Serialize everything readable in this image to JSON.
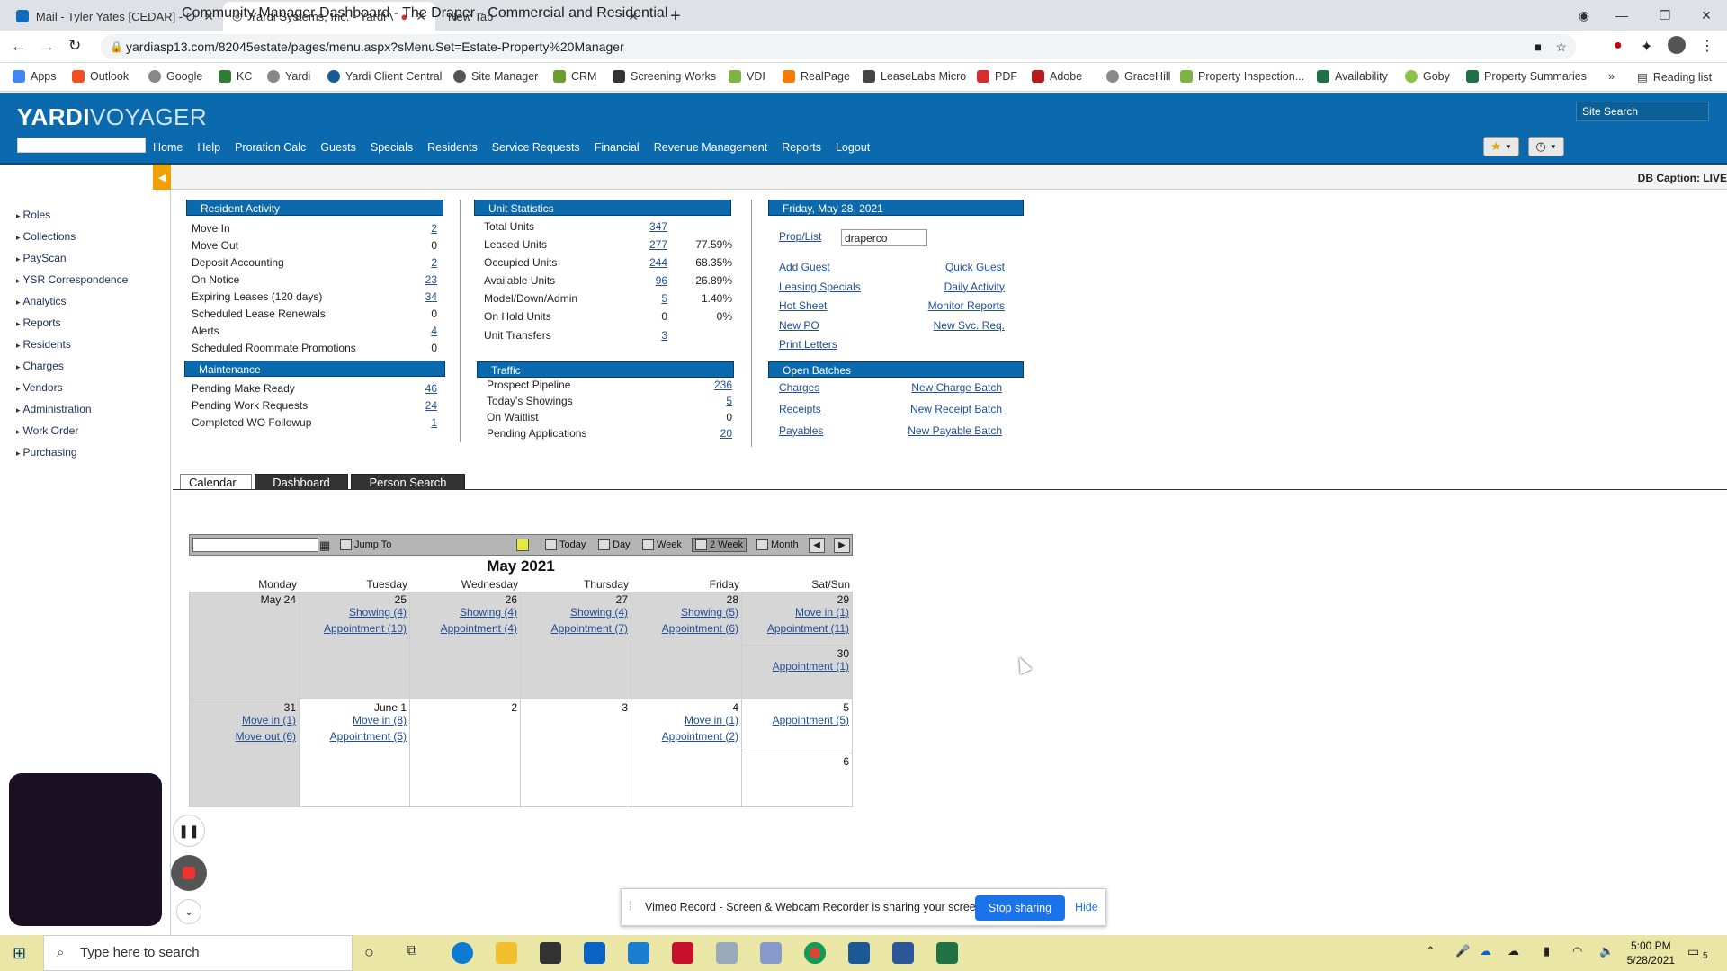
{
  "browser": {
    "tabs": [
      {
        "title": "Mail - Tyler Yates [CEDAR] - Outl"
      },
      {
        "title": "Yardi Systems, Inc. - Yardi Vo"
      },
      {
        "title": "New Tab"
      }
    ],
    "url": "yardiasp13.com/82045estate/pages/menu.aspx?sMenuSet=Estate-Property%20Manager",
    "bookmarks": [
      "Apps",
      "Outlook",
      "Google",
      "KC",
      "Yardi",
      "Yardi Client Central",
      "Site Manager",
      "CRM",
      "Screening Works",
      "VDI",
      "RealPage",
      "LeaseLabs Micro",
      "PDF",
      "Adobe",
      "GraceHill",
      "Property Inspection...",
      "Availability",
      "Goby",
      "Property Summaries"
    ],
    "reading_list": "Reading list",
    "more": "»"
  },
  "app": {
    "logo_bold": "YARDI",
    "logo_light": "VOYAGER",
    "site_search": "Site Search",
    "nav": [
      "Home",
      "Help",
      "Proration Calc",
      "Guests",
      "Specials",
      "Residents",
      "Service Requests",
      "Financial",
      "Revenue Management",
      "Reports",
      "Logout"
    ],
    "page_title": "Community Manager Dashboard - The Draper - Commercial and Residential",
    "db_caption": "DB Caption: LIVE"
  },
  "left_menu": [
    "Roles",
    "Collections",
    "PayScan",
    "YSR Correspondence",
    "Analytics",
    "Reports",
    "Residents",
    "Charges",
    "Vendors",
    "Administration",
    "Work Order",
    "Purchasing"
  ],
  "resident_activity": {
    "header": "Resident Activity",
    "rows": [
      {
        "label": "Move In",
        "value": "2",
        "link": true
      },
      {
        "label": "Move Out",
        "value": "0",
        "link": false
      },
      {
        "label": "Deposit Accounting",
        "value": "2",
        "link": true
      },
      {
        "label": "On Notice",
        "value": "23",
        "link": true
      },
      {
        "label": "Expiring Leases (120 days)",
        "value": "34",
        "link": true
      },
      {
        "label": "Scheduled Lease Renewals",
        "value": "0",
        "link": false
      },
      {
        "label": "Alerts",
        "value": "4",
        "link": true
      },
      {
        "label": "Scheduled Roommate Promotions",
        "value": "0",
        "link": false
      }
    ]
  },
  "maintenance": {
    "header": "Maintenance",
    "rows": [
      {
        "label": "Pending Make Ready",
        "value": "46",
        "link": true
      },
      {
        "label": "Pending Work Requests",
        "value": "24",
        "link": true
      },
      {
        "label": "Completed WO Followup",
        "value": "1",
        "link": true
      }
    ]
  },
  "unit_statistics": {
    "header": "Unit Statistics",
    "rows": [
      {
        "label": "Total Units",
        "value": "347",
        "link": true,
        "pct": ""
      },
      {
        "label": "Leased Units",
        "value": "277",
        "link": true,
        "pct": "77.59%"
      },
      {
        "label": "Occupied Units",
        "value": "244",
        "link": true,
        "pct": "68.35%"
      },
      {
        "label": "Available Units",
        "value": "96",
        "link": true,
        "pct": "26.89%"
      },
      {
        "label": "Model/Down/Admin",
        "value": "5",
        "link": true,
        "pct": "1.40%"
      },
      {
        "label": "On Hold Units",
        "value": "0",
        "link": false,
        "pct": "0%"
      },
      {
        "label": "Unit Transfers",
        "value": "3",
        "link": true,
        "pct": ""
      }
    ]
  },
  "traffic": {
    "header": "Traffic",
    "rows": [
      {
        "label": "Prospect Pipeline",
        "value": "236",
        "link": true
      },
      {
        "label": "Today's Showings",
        "value": "5",
        "link": true
      },
      {
        "label": "On Waitlist",
        "value": "0",
        "link": false
      },
      {
        "label": "Pending Applications",
        "value": "20",
        "link": true
      }
    ]
  },
  "date_panel": {
    "header": "Friday, May 28, 2021",
    "prop_label": "Prop/List",
    "prop_value": "draperco",
    "links": [
      [
        "Add Guest",
        "Quick Guest"
      ],
      [
        "Leasing Specials",
        "Daily Activity"
      ],
      [
        "Hot Sheet",
        "Monitor Reports"
      ],
      [
        "New PO",
        "New Svc. Req."
      ],
      [
        "Print Letters",
        ""
      ]
    ]
  },
  "open_batches": {
    "header": "Open Batches",
    "links": [
      [
        "Charges",
        "New Charge Batch"
      ],
      [
        "Receipts",
        "New Receipt Batch"
      ],
      [
        "Payables",
        "New Payable Batch"
      ]
    ]
  },
  "calendar": {
    "tabs": [
      "Calendar",
      "Dashboard",
      "Person Search"
    ],
    "toolbar": {
      "jump": "Jump To",
      "today": "Today",
      "day": "Day",
      "week": "Week",
      "two_week": "2 Week",
      "month": "Month"
    },
    "month_title": "May 2021",
    "dow": [
      "Monday",
      "Tuesday",
      "Wednesday",
      "Thursday",
      "Friday",
      "Sat/Sun"
    ],
    "week1": [
      {
        "day": "May 24",
        "links": []
      },
      {
        "day": "25",
        "links": [
          "Showing (4)",
          "Appointment (10)"
        ]
      },
      {
        "day": "26",
        "links": [
          "Showing (4)",
          "Appointment (4)"
        ]
      },
      {
        "day": "27",
        "links": [
          "Showing (4)",
          "Appointment (7)"
        ]
      },
      {
        "day": "28",
        "links": [
          "Showing (5)",
          "Appointment (6)"
        ]
      },
      {
        "day": "29",
        "links": [
          "Move in (1)",
          "Appointment (11)"
        ]
      },
      {
        "day": "30",
        "links": [
          "Appointment (1)"
        ]
      }
    ],
    "week2": [
      {
        "day": "31",
        "links": [
          "Move in (1)",
          "Move out (6)"
        ]
      },
      {
        "day": "June 1",
        "links": [
          "Move in (8)",
          "Appointment (5)"
        ]
      },
      {
        "day": "2",
        "links": []
      },
      {
        "day": "3",
        "links": []
      },
      {
        "day": "4",
        "links": [
          "Move in (1)",
          "Appointment (2)"
        ]
      },
      {
        "day": "5",
        "links": [
          "Appointment (5)"
        ]
      },
      {
        "day": "6",
        "links": []
      }
    ]
  },
  "share_bar": {
    "text": "Vimeo Record - Screen & Webcam Recorder is sharing your screen.",
    "stop": "Stop sharing",
    "hide": "Hide"
  },
  "taskbar": {
    "search_placeholder": "Type here to search",
    "time": "5:00 PM",
    "date": "5/28/2021",
    "notifications": "5"
  }
}
